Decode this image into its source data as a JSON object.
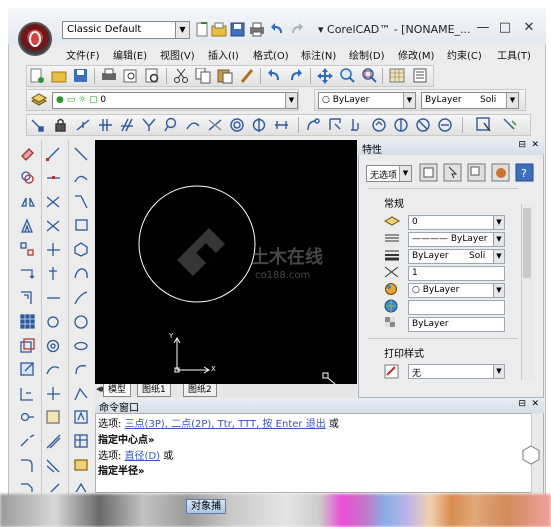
{
  "app": {
    "profile_select": "Classic Default",
    "title": "▾ CorelCAD™ - [NONAME_..."
  },
  "window_buttons": {
    "minimize": "—",
    "maximize": "□",
    "close": "✕"
  },
  "menu": [
    "文件(F)",
    "编辑(E)",
    "视图(V)",
    "插入(I)",
    "格式(O)",
    "标注(N)",
    "绘制(D)",
    "修改(M)",
    "约束(C)",
    "工具(T)"
  ],
  "layer_bar": {
    "layer_value": "0",
    "color_value": "ByLayer",
    "linetype_value": "ByLayer",
    "lineweight_value": "Soli"
  },
  "properties": {
    "title": "特性",
    "selection": "无选项",
    "group_general": "常规",
    "rows": [
      {
        "icon": "layer-icon",
        "value": "0"
      },
      {
        "icon": "linetype-icon",
        "value": "———— ByLayer"
      },
      {
        "icon": "lineweight-icon",
        "value": "ByLayer",
        "extra": "Soli"
      },
      {
        "icon": "scale-icon",
        "value": "1"
      },
      {
        "icon": "color-icon",
        "value": "○ ByLayer"
      },
      {
        "icon": "globe-icon",
        "value": ""
      },
      {
        "icon": "transparency-icon",
        "value": "ByLayer"
      }
    ],
    "group_print": "打印样式",
    "print_value": "无"
  },
  "sheet_tabs": [
    "模型",
    "图纸1",
    "图纸2"
  ],
  "command": {
    "title": "命令窗口",
    "lines": [
      {
        "prefix": "选项: ",
        "links": "三点(3P), 二点(2P), Ttr, TTT, 按 Enter 退出",
        "suffix": " 或"
      },
      {
        "text": "指定中心点»"
      },
      {
        "prefix": "选项: ",
        "links": "直径(D)",
        "suffix": " 或"
      },
      {
        "text": "指定半径»"
      }
    ]
  },
  "status": {
    "snap_button": "对象捕"
  },
  "watermark": {
    "text": "土木在线",
    "subtext": "co188.com"
  }
}
